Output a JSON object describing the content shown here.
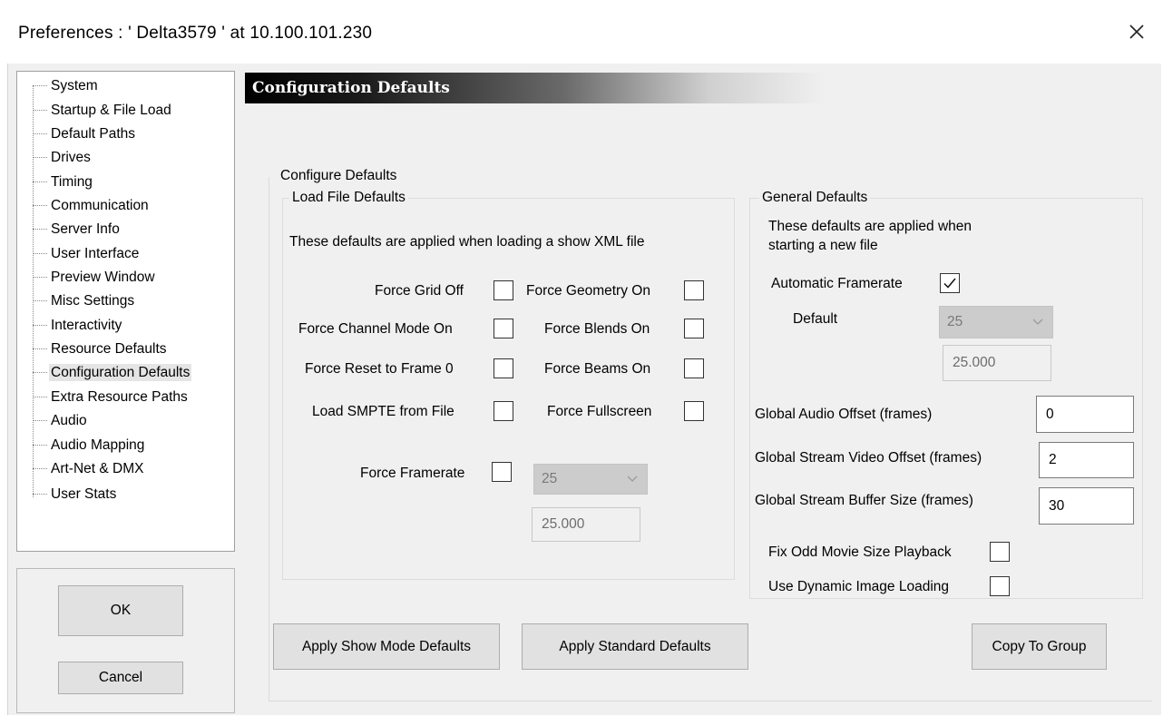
{
  "window": {
    "title": "Preferences  :  ' Delta3579 ' at 10.100.101.230",
    "close_icon": "close-icon"
  },
  "sidebar": {
    "items": [
      {
        "label": "System"
      },
      {
        "label": "Startup & File Load"
      },
      {
        "label": "Default Paths"
      },
      {
        "label": "Drives"
      },
      {
        "label": "Timing"
      },
      {
        "label": "Communication"
      },
      {
        "label": "Server Info"
      },
      {
        "label": "User Interface"
      },
      {
        "label": "Preview Window"
      },
      {
        "label": "Misc Settings"
      },
      {
        "label": "Interactivity"
      },
      {
        "label": "Resource Defaults"
      },
      {
        "label": "Configuration Defaults",
        "selected": true
      },
      {
        "label": "Extra Resource Paths"
      },
      {
        "label": "Audio"
      },
      {
        "label": "Audio Mapping"
      },
      {
        "label": "Art-Net & DMX"
      },
      {
        "label": "User Stats"
      }
    ]
  },
  "dialog_buttons": {
    "ok_label": "OK",
    "cancel_label": "Cancel"
  },
  "main": {
    "header": "Configuration Defaults",
    "configure_group_title": "Configure Defaults",
    "load_file": {
      "title": "Load File Defaults",
      "description": "These defaults are applied when loading a show XML file",
      "options": {
        "force_grid_off": {
          "label": "Force Grid Off",
          "checked": false
        },
        "force_geometry_on": {
          "label": "Force Geometry On",
          "checked": false
        },
        "force_channel_mode_on": {
          "label": "Force Channel Mode On",
          "checked": false
        },
        "force_blends_on": {
          "label": "Force Blends On",
          "checked": false
        },
        "force_reset_to_frame_0": {
          "label": "Force Reset to Frame 0",
          "checked": false
        },
        "force_beams_on": {
          "label": "Force Beams On",
          "checked": false
        },
        "load_smpte_from_file": {
          "label": "Load SMPTE from File",
          "checked": false
        },
        "force_fullscreen": {
          "label": "Force Fullscreen",
          "checked": false
        },
        "force_framerate": {
          "label": "Force Framerate",
          "checked": false
        }
      },
      "framerate_select": "25",
      "framerate_value": "25.000"
    },
    "general": {
      "title": "General Defaults",
      "description_line1": "These defaults are applied when",
      "description_line2": "starting a new file",
      "automatic_framerate": {
        "label": "Automatic Framerate",
        "checked": true
      },
      "default_label": "Default",
      "default_select": "25",
      "default_value": "25.000",
      "global_audio_offset": {
        "label": "Global Audio Offset (frames)",
        "value": "0"
      },
      "global_stream_video_offset": {
        "label": "Global Stream Video Offset (frames)",
        "value": "2"
      },
      "global_stream_buffer_size": {
        "label": "Global Stream Buffer Size (frames)",
        "value": "30"
      },
      "fix_odd_movie_size_playback": {
        "label": "Fix Odd Movie Size Playback",
        "checked": false
      },
      "use_dynamic_image_loading": {
        "label": "Use Dynamic Image Loading",
        "checked": false
      }
    },
    "buttons": {
      "apply_show_mode": "Apply Show Mode Defaults",
      "apply_standard": "Apply Standard Defaults",
      "copy_to_group": "Copy To Group"
    }
  }
}
